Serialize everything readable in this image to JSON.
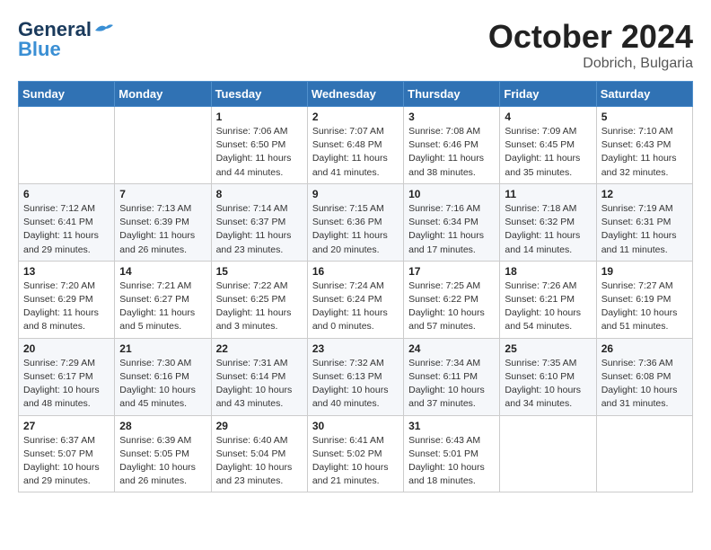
{
  "header": {
    "logo_line1": "General",
    "logo_line2": "Blue",
    "month_year": "October 2024",
    "location": "Dobrich, Bulgaria"
  },
  "weekdays": [
    "Sunday",
    "Monday",
    "Tuesday",
    "Wednesday",
    "Thursday",
    "Friday",
    "Saturday"
  ],
  "weeks": [
    [
      {
        "day": "",
        "info": ""
      },
      {
        "day": "",
        "info": ""
      },
      {
        "day": "1",
        "info": "Sunrise: 7:06 AM\nSunset: 6:50 PM\nDaylight: 11 hours and 44 minutes."
      },
      {
        "day": "2",
        "info": "Sunrise: 7:07 AM\nSunset: 6:48 PM\nDaylight: 11 hours and 41 minutes."
      },
      {
        "day": "3",
        "info": "Sunrise: 7:08 AM\nSunset: 6:46 PM\nDaylight: 11 hours and 38 minutes."
      },
      {
        "day": "4",
        "info": "Sunrise: 7:09 AM\nSunset: 6:45 PM\nDaylight: 11 hours and 35 minutes."
      },
      {
        "day": "5",
        "info": "Sunrise: 7:10 AM\nSunset: 6:43 PM\nDaylight: 11 hours and 32 minutes."
      }
    ],
    [
      {
        "day": "6",
        "info": "Sunrise: 7:12 AM\nSunset: 6:41 PM\nDaylight: 11 hours and 29 minutes."
      },
      {
        "day": "7",
        "info": "Sunrise: 7:13 AM\nSunset: 6:39 PM\nDaylight: 11 hours and 26 minutes."
      },
      {
        "day": "8",
        "info": "Sunrise: 7:14 AM\nSunset: 6:37 PM\nDaylight: 11 hours and 23 minutes."
      },
      {
        "day": "9",
        "info": "Sunrise: 7:15 AM\nSunset: 6:36 PM\nDaylight: 11 hours and 20 minutes."
      },
      {
        "day": "10",
        "info": "Sunrise: 7:16 AM\nSunset: 6:34 PM\nDaylight: 11 hours and 17 minutes."
      },
      {
        "day": "11",
        "info": "Sunrise: 7:18 AM\nSunset: 6:32 PM\nDaylight: 11 hours and 14 minutes."
      },
      {
        "day": "12",
        "info": "Sunrise: 7:19 AM\nSunset: 6:31 PM\nDaylight: 11 hours and 11 minutes."
      }
    ],
    [
      {
        "day": "13",
        "info": "Sunrise: 7:20 AM\nSunset: 6:29 PM\nDaylight: 11 hours and 8 minutes."
      },
      {
        "day": "14",
        "info": "Sunrise: 7:21 AM\nSunset: 6:27 PM\nDaylight: 11 hours and 5 minutes."
      },
      {
        "day": "15",
        "info": "Sunrise: 7:22 AM\nSunset: 6:25 PM\nDaylight: 11 hours and 3 minutes."
      },
      {
        "day": "16",
        "info": "Sunrise: 7:24 AM\nSunset: 6:24 PM\nDaylight: 11 hours and 0 minutes."
      },
      {
        "day": "17",
        "info": "Sunrise: 7:25 AM\nSunset: 6:22 PM\nDaylight: 10 hours and 57 minutes."
      },
      {
        "day": "18",
        "info": "Sunrise: 7:26 AM\nSunset: 6:21 PM\nDaylight: 10 hours and 54 minutes."
      },
      {
        "day": "19",
        "info": "Sunrise: 7:27 AM\nSunset: 6:19 PM\nDaylight: 10 hours and 51 minutes."
      }
    ],
    [
      {
        "day": "20",
        "info": "Sunrise: 7:29 AM\nSunset: 6:17 PM\nDaylight: 10 hours and 48 minutes."
      },
      {
        "day": "21",
        "info": "Sunrise: 7:30 AM\nSunset: 6:16 PM\nDaylight: 10 hours and 45 minutes."
      },
      {
        "day": "22",
        "info": "Sunrise: 7:31 AM\nSunset: 6:14 PM\nDaylight: 10 hours and 43 minutes."
      },
      {
        "day": "23",
        "info": "Sunrise: 7:32 AM\nSunset: 6:13 PM\nDaylight: 10 hours and 40 minutes."
      },
      {
        "day": "24",
        "info": "Sunrise: 7:34 AM\nSunset: 6:11 PM\nDaylight: 10 hours and 37 minutes."
      },
      {
        "day": "25",
        "info": "Sunrise: 7:35 AM\nSunset: 6:10 PM\nDaylight: 10 hours and 34 minutes."
      },
      {
        "day": "26",
        "info": "Sunrise: 7:36 AM\nSunset: 6:08 PM\nDaylight: 10 hours and 31 minutes."
      }
    ],
    [
      {
        "day": "27",
        "info": "Sunrise: 6:37 AM\nSunset: 5:07 PM\nDaylight: 10 hours and 29 minutes."
      },
      {
        "day": "28",
        "info": "Sunrise: 6:39 AM\nSunset: 5:05 PM\nDaylight: 10 hours and 26 minutes."
      },
      {
        "day": "29",
        "info": "Sunrise: 6:40 AM\nSunset: 5:04 PM\nDaylight: 10 hours and 23 minutes."
      },
      {
        "day": "30",
        "info": "Sunrise: 6:41 AM\nSunset: 5:02 PM\nDaylight: 10 hours and 21 minutes."
      },
      {
        "day": "31",
        "info": "Sunrise: 6:43 AM\nSunset: 5:01 PM\nDaylight: 10 hours and 18 minutes."
      },
      {
        "day": "",
        "info": ""
      },
      {
        "day": "",
        "info": ""
      }
    ]
  ]
}
